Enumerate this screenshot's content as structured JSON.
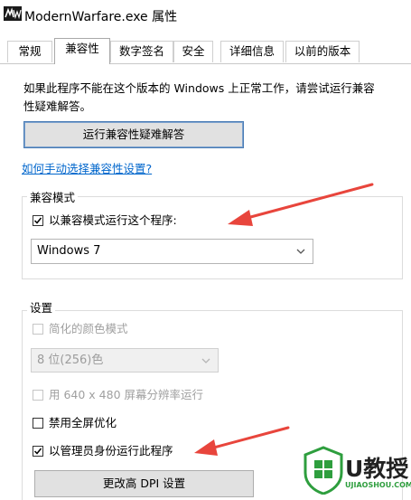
{
  "window": {
    "title": "ModernWarfare.exe 属性",
    "icon": "mw-app-icon"
  },
  "tabs": [
    {
      "label": "常规",
      "active": false
    },
    {
      "label": "兼容性",
      "active": true
    },
    {
      "label": "数字签名",
      "active": false
    },
    {
      "label": "安全",
      "active": false
    },
    {
      "label": "详细信息",
      "active": false
    },
    {
      "label": "以前的版本",
      "active": false
    }
  ],
  "compat": {
    "description_line1": "如果此程序不能在这个版本的 Windows 上正常工作，请尝试运行兼容",
    "description_line2": "性疑难解答。",
    "troubleshoot_button": "运行兼容性疑难解答",
    "manual_link": "如何手动选择兼容性设置?"
  },
  "compat_mode": {
    "group_title": "兼容模式",
    "checkbox_label": "以兼容模式运行这个程序:",
    "checked": true,
    "selected_os": "Windows 7"
  },
  "settings": {
    "group_title": "设置",
    "reduced_color_label": "简化的颜色模式",
    "reduced_color_checked": false,
    "color_depth": "8 位(256)色",
    "res_640_label": "用 640 x 480 屏幕分辨率运行",
    "res_640_checked": false,
    "disable_fullscreen_label": "禁用全屏优化",
    "disable_fullscreen_checked": false,
    "run_as_admin_label": "以管理员身份运行此程序",
    "run_as_admin_checked": true,
    "dpi_button": "更改高 DPI 设置"
  },
  "watermark": {
    "brand_text": "U教授",
    "url_text": "UJIAOSHOU.COM"
  },
  "colors": {
    "accent_green": "#2e9e3e",
    "arrow_red": "#e8453c",
    "link_blue": "#0066cc"
  }
}
